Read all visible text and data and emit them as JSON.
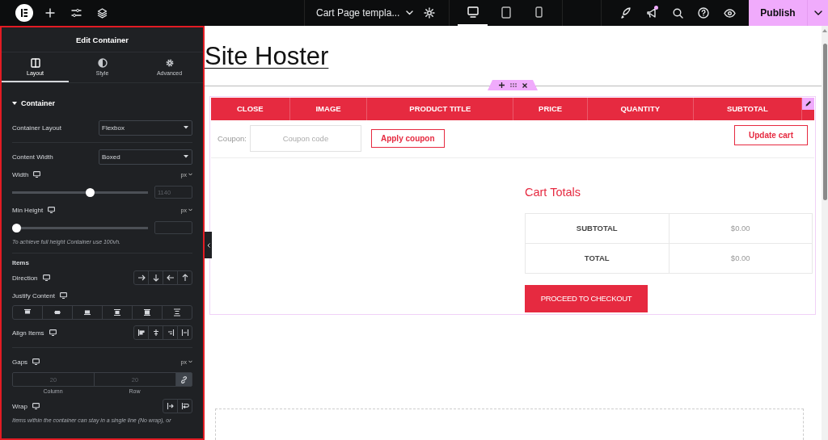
{
  "topbar": {
    "document_title": "Cart Page templa...",
    "devices": [
      {
        "selected": true
      },
      {
        "selected": false
      },
      {
        "selected": false
      }
    ],
    "has_notification": true,
    "publish_button": "Publish"
  },
  "panel": {
    "title": "Edit Container",
    "tabs": [
      {
        "label": "Layout",
        "selected": true
      },
      {
        "label": "Style",
        "selected": false
      },
      {
        "label": "Advanced",
        "selected": false
      }
    ],
    "section": {
      "title": "Container",
      "expanded": true
    },
    "groups": [
      [
        {
          "kind": "select",
          "label": "Container Layout",
          "value": "Flexbox"
        }
      ],
      [
        {
          "kind": "select",
          "label": "Content Width",
          "value": "Boxed"
        },
        {
          "kind": "slider",
          "label": "Width",
          "responsive": true,
          "unit": "px",
          "level": 0.58,
          "placeholder": "1140"
        },
        {
          "kind": "slider",
          "label": "Min Height",
          "responsive": true,
          "unit": "px",
          "level": 0
        },
        {
          "kind": "note",
          "text": "To achieve full height Container use 100vh."
        }
      ],
      [
        {
          "kind": "heading",
          "text": "Items"
        },
        {
          "kind": "direction",
          "label": "Direction",
          "responsive": true
        },
        {
          "kind": "justify",
          "label": "Justify Content",
          "responsive": true
        },
        {
          "kind": "align",
          "label": "Align Items",
          "responsive": true
        }
      ],
      [
        {
          "kind": "gaps",
          "label": "Gaps",
          "responsive": true,
          "unit": "px",
          "linked": true,
          "fields": [
            {
              "placeholder": "20",
              "caption": "Column"
            },
            {
              "placeholder": "20",
              "caption": "Row"
            }
          ]
        },
        {
          "kind": "wrap",
          "label": "Wrap",
          "responsive": true
        },
        {
          "kind": "note",
          "text": "Items within the container can stay in a single line (No wrap), or"
        }
      ]
    ]
  },
  "canvas": {
    "site_title": "Site Hoster",
    "cart": {
      "columns": [
        "CLOSE",
        "IMAGE",
        "PRODUCT TITLE",
        "PRICE",
        "QUANTITY",
        "SUBTOTAL"
      ],
      "coupon_label": "Coupon:",
      "coupon_placeholder": "Coupon code",
      "apply_button": "Apply coupon",
      "update_button": "Update cart"
    },
    "totals": {
      "title": "Cart Totals",
      "rows": [
        {
          "label": "SUBTOTAL",
          "value": "$0.00"
        },
        {
          "label": "TOTAL",
          "value": "$0.00"
        }
      ],
      "checkout_button": "PROCEED TO CHECKOUT"
    }
  }
}
